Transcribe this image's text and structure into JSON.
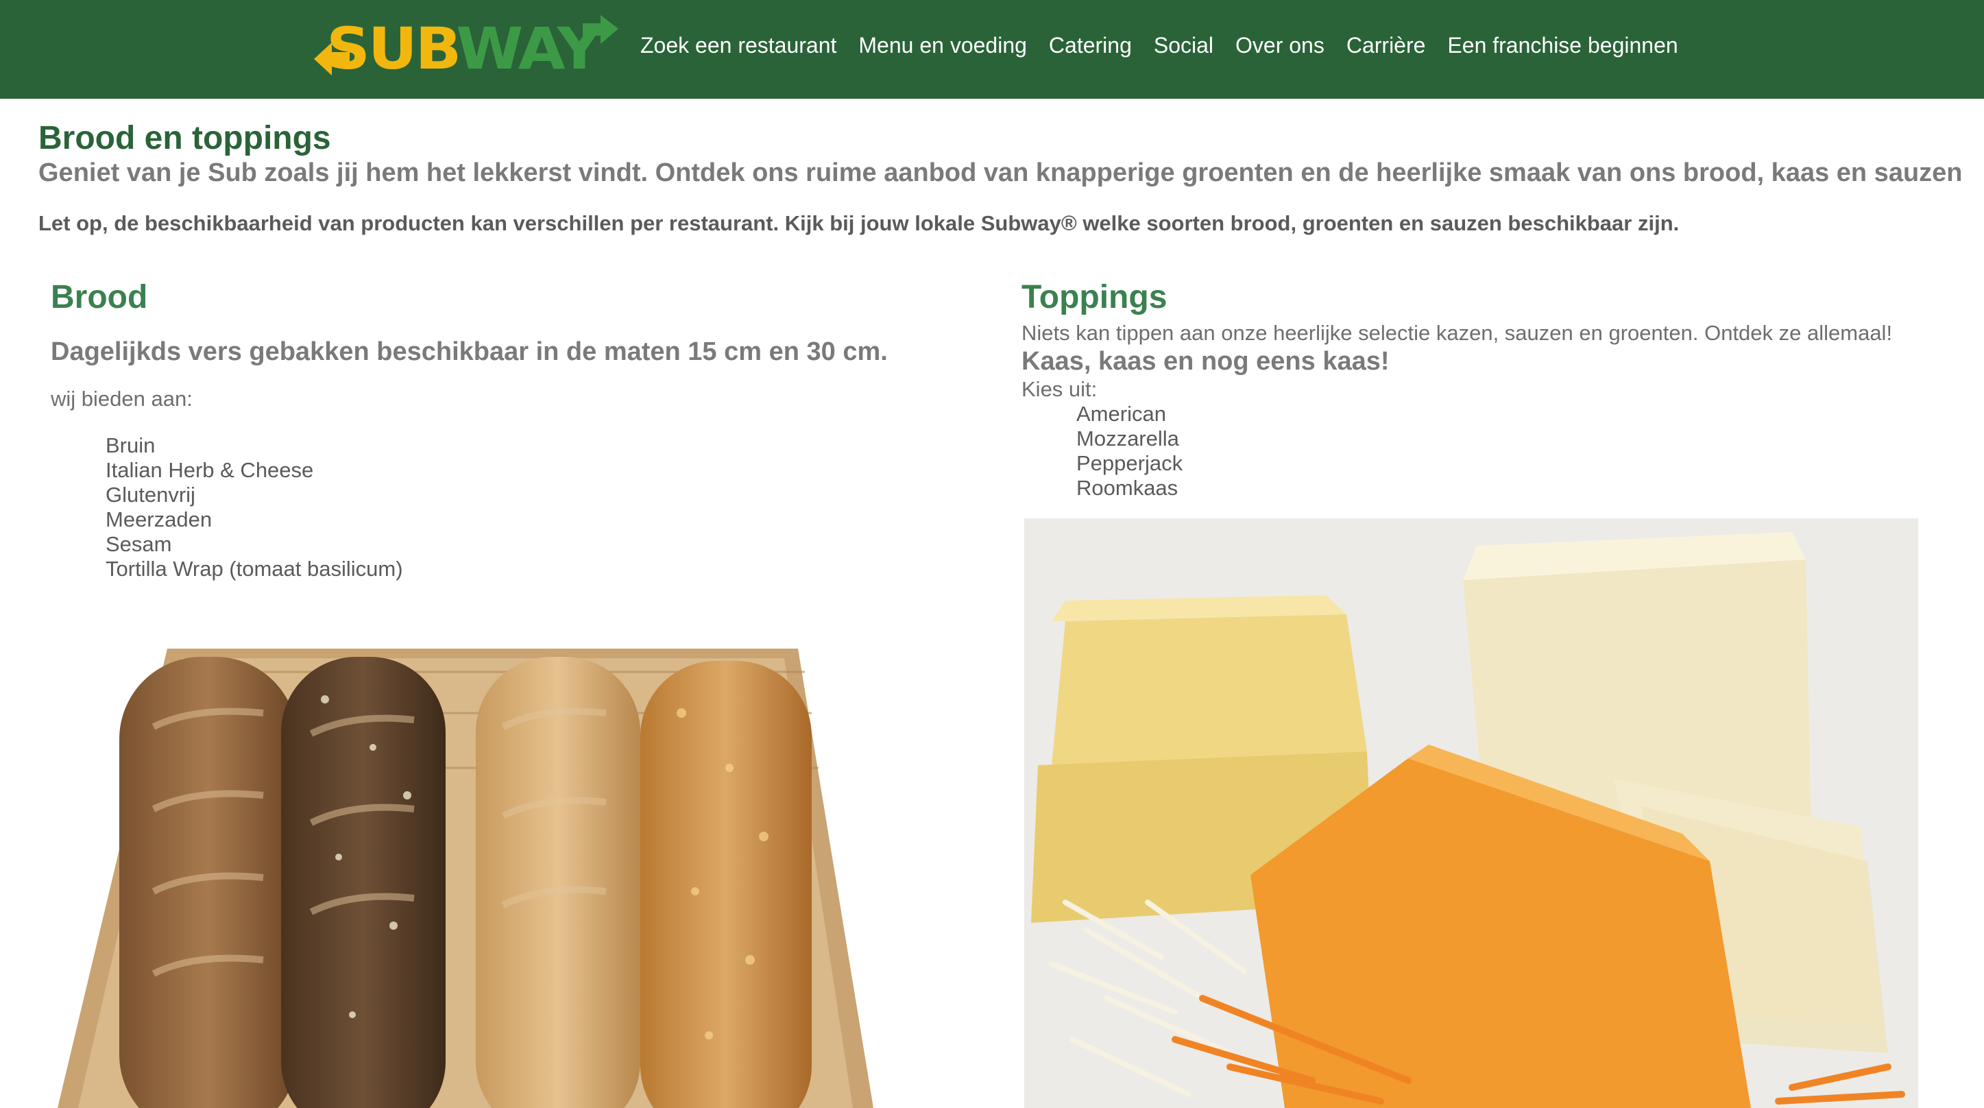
{
  "header": {
    "brand_name": "SUBWAY",
    "brand_color_yellow": "#f2b70f",
    "brand_color_green": "#3c9a47",
    "background_color": "#2a6338",
    "nav": [
      {
        "label": "Zoek een restaurant"
      },
      {
        "label": "Menu en voeding"
      },
      {
        "label": "Catering"
      },
      {
        "label": "Social"
      },
      {
        "label": "Over ons"
      },
      {
        "label": "Carrière"
      },
      {
        "label": "Een franchise beginnen"
      }
    ]
  },
  "intro": {
    "title": "Brood en toppings",
    "subtitle": "Geniet van je Sub zoals jij hem het lekkerst vindt. Ontdek ons ruime aanbod van knapperige groenten en de heerlijke smaak van ons brood, kaas en sauzen",
    "notice": "Let op, de beschikbaarheid van producten kan verschillen per restaurant. Kijk bij jouw lokale Subway® welke soorten brood, groenten en sauzen beschikbaar zijn."
  },
  "bread": {
    "title": "Brood",
    "lead": "Dagelijkds vers gebakken beschikbaar in de maten 15 cm en 30 cm.",
    "offer_label": "wij bieden aan:",
    "items": [
      "Bruin",
      "Italian Herb & Cheese",
      "Glutenvrij",
      "Meerzaden",
      "Sesam",
      "Tortilla Wrap (tomaat basilicum)"
    ],
    "photo_icon": "bread-basket-photo"
  },
  "toppings": {
    "title": "Toppings",
    "intro": "Niets kan tippen aan onze heerlijke selectie kazen, sauzen en groenten. Ontdek ze allemaal!",
    "cheese_heading": "Kaas, kaas en nog eens kaas!",
    "choose_label": "Kies uit:",
    "cheeses": [
      "American",
      "Mozzarella",
      "Pepperjack",
      "Roomkaas"
    ],
    "photo_icon": "cheese-photo"
  },
  "colors": {
    "title_green": "#2a6338",
    "section_green": "#3b8150",
    "text_gray": "#7a7a7a"
  }
}
